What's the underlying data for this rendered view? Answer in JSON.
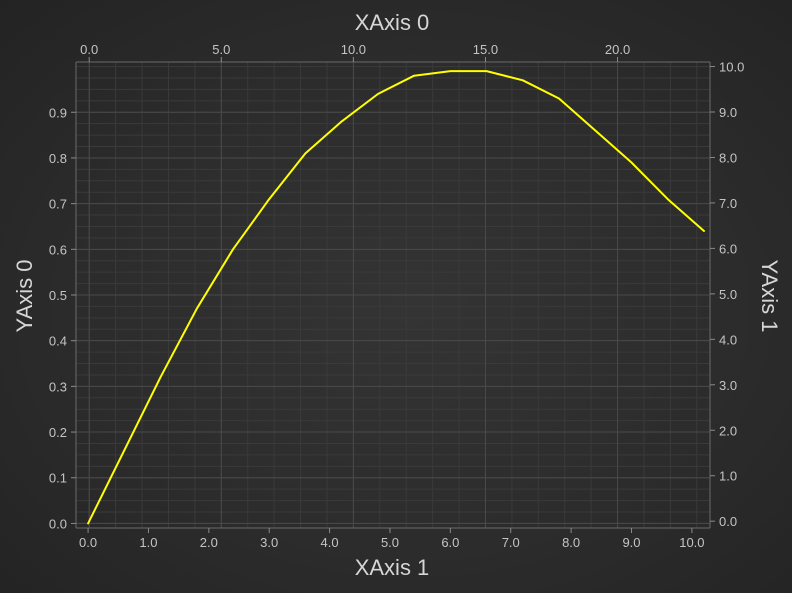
{
  "chart_data": {
    "type": "line",
    "title": "",
    "series": [
      {
        "color": "#ffff00",
        "x": [
          0.0,
          0.6,
          1.2,
          1.8,
          2.4,
          3.0,
          3.6,
          4.2,
          4.8,
          5.4,
          6.0,
          6.6,
          7.2,
          7.8,
          8.4,
          9.0,
          9.6,
          10.2
        ],
        "y": [
          0.0,
          0.16,
          0.32,
          0.47,
          0.6,
          0.71,
          0.81,
          0.88,
          0.94,
          0.98,
          0.99,
          0.99,
          0.97,
          0.93,
          0.86,
          0.79,
          0.71,
          0.64
        ]
      }
    ],
    "axes": {
      "x_bottom": {
        "label": "XAxis 1",
        "range": [
          -0.2,
          10.3
        ],
        "ticks": [
          0,
          1,
          2,
          3,
          4,
          5,
          6,
          7,
          8,
          9,
          10
        ],
        "tick_labels": [
          "0.0",
          "1.0",
          "2.0",
          "3.0",
          "4.0",
          "5.0",
          "6.0",
          "7.0",
          "8.0",
          "9.0",
          "10.0"
        ]
      },
      "x_top": {
        "label": "XAxis 0",
        "range": [
          -0.5,
          23.5
        ],
        "ticks": [
          0,
          5,
          10,
          15,
          20
        ],
        "tick_labels": [
          "0.0",
          "5.0",
          "10.0",
          "15.0",
          "20.0"
        ]
      },
      "y_left": {
        "label": "YAxis 0",
        "range": [
          -0.01,
          1.01
        ],
        "ticks": [
          0,
          0.1,
          0.2,
          0.3,
          0.4,
          0.5,
          0.6,
          0.7,
          0.8,
          0.9
        ],
        "tick_labels": [
          "0.0",
          "0.1",
          "0.2",
          "0.3",
          "0.4",
          "0.5",
          "0.6",
          "0.7",
          "0.8",
          "0.9"
        ]
      },
      "y_right": {
        "label": "YAxis 1",
        "range": [
          -0.15,
          10.1
        ],
        "ticks": [
          0,
          1,
          2,
          3,
          4,
          5,
          6,
          7,
          8,
          9,
          10
        ],
        "tick_labels": [
          "0.0",
          "1.0",
          "2.0",
          "3.0",
          "4.0",
          "5.0",
          "6.0",
          "7.0",
          "8.0",
          "9.0",
          "10.0"
        ]
      }
    },
    "grid": true,
    "legend": "none"
  }
}
